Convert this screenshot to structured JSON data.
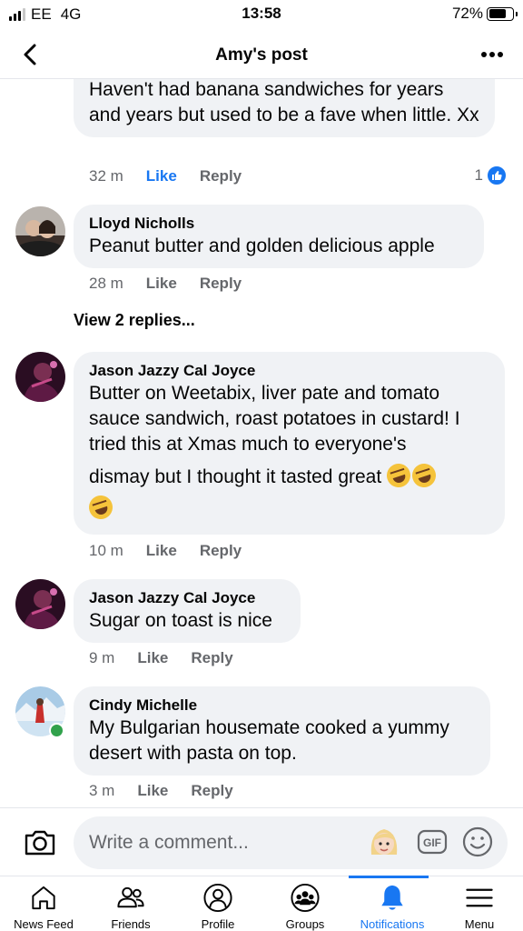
{
  "status_bar": {
    "carrier": "EE",
    "network": "4G",
    "time": "13:58",
    "battery": "72%",
    "battery_level": 0.72
  },
  "header": {
    "title": "Amy's post"
  },
  "comments": [
    {
      "text": "Haven't had banana sandwiches for years and years but used to be a fave when little. Xx",
      "time": "32 m",
      "like_label": "Like",
      "reply_label": "Reply",
      "liked": true,
      "reaction_count": "1"
    },
    {
      "name": "Lloyd Nicholls",
      "text": "Peanut butter and golden delicious  apple",
      "time": "28 m",
      "like_label": "Like",
      "reply_label": "Reply"
    },
    {
      "name": "Jason Jazzy Cal Joyce",
      "text_lines": [
        "Butter on Weetabix, liver pate and tomato",
        "sauce sandwich, roast potatoes in custard! I",
        "tried this at Xmas much to everyone's",
        "dismay but I thought it tasted great"
      ],
      "emoji": "rolling-on-floor-laughing",
      "time": "10 m",
      "like_label": "Like",
      "reply_label": "Reply"
    },
    {
      "name": "Jason Jazzy Cal Joyce",
      "text": "Sugar on toast is nice",
      "time": "9 m",
      "like_label": "Like",
      "reply_label": "Reply"
    },
    {
      "name": "Cindy Michelle",
      "text_lines": [
        "My Bulgarian housemate cooked a yummy",
        "desert with pasta on top."
      ],
      "time": "3 m",
      "like_label": "Like",
      "reply_label": "Reply",
      "online": true
    }
  ],
  "view_replies": "View 2 replies...",
  "composer": {
    "placeholder": "Write a comment...",
    "gif_label": "GIF"
  },
  "tabs": [
    {
      "label": "News Feed",
      "icon": "home-icon"
    },
    {
      "label": "Friends",
      "icon": "friends-icon"
    },
    {
      "label": "Profile",
      "icon": "profile-icon"
    },
    {
      "label": "Groups",
      "icon": "groups-icon"
    },
    {
      "label": "Notifications",
      "icon": "bell-icon",
      "active": true
    },
    {
      "label": "Menu",
      "icon": "menu-icon"
    }
  ],
  "colors": {
    "accent": "#1877f2",
    "bubble": "#f0f2f5",
    "secondary_text": "#65676b",
    "online": "#31a24c"
  }
}
